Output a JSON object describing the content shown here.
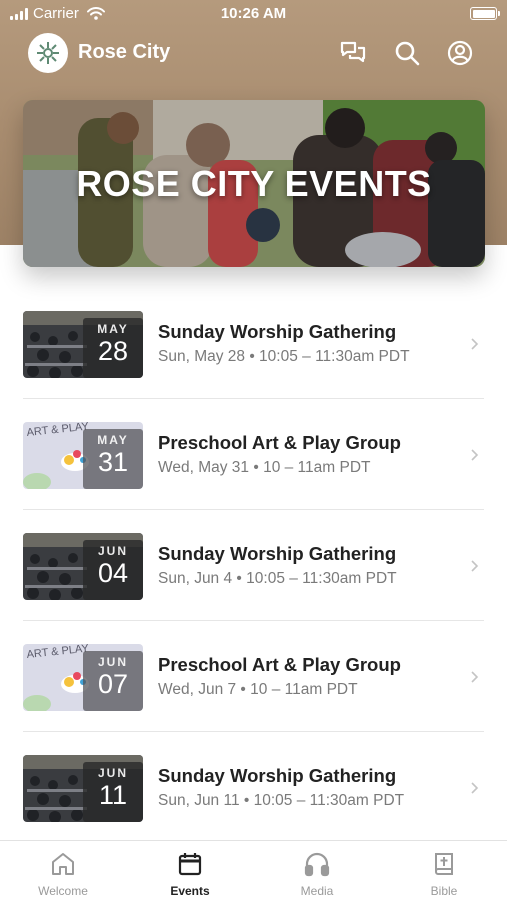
{
  "status_bar": {
    "carrier": "Carrier",
    "time": "10:26 AM"
  },
  "header": {
    "app_title": "Rose City"
  },
  "hero": {
    "title": "ROSE CITY EVENTS"
  },
  "events": [
    {
      "month": "MAY",
      "day": "28",
      "title": "Sunday Worship Gathering",
      "time": "Sun, May 28 • 10:05 – 11:30am PDT",
      "thumb": "worship"
    },
    {
      "month": "MAY",
      "day": "31",
      "title": "Preschool Art & Play Group",
      "time": "Wed, May 31 • 10 – 11am PDT",
      "thumb": "art"
    },
    {
      "month": "JUN",
      "day": "04",
      "title": "Sunday Worship Gathering",
      "time": "Sun, Jun 4 • 10:05 – 11:30am PDT",
      "thumb": "worship"
    },
    {
      "month": "JUN",
      "day": "07",
      "title": "Preschool Art & Play Group",
      "time": "Wed, Jun 7 • 10 – 11am PDT",
      "thumb": "art"
    },
    {
      "month": "JUN",
      "day": "11",
      "title": "Sunday Worship Gathering",
      "time": "Sun, Jun 11 • 10:05 – 11:30am PDT",
      "thumb": "worship"
    }
  ],
  "tabs": [
    {
      "label": "Welcome",
      "icon": "home-icon",
      "active": false
    },
    {
      "label": "Events",
      "icon": "calendar-icon",
      "active": true
    },
    {
      "label": "Media",
      "icon": "headphones-icon",
      "active": false
    },
    {
      "label": "Bible",
      "icon": "bible-icon",
      "active": false
    }
  ],
  "colors": {
    "header_bg": "#a88c6f",
    "active_tab": "#222222",
    "inactive_tab": "#9a9a9a"
  }
}
